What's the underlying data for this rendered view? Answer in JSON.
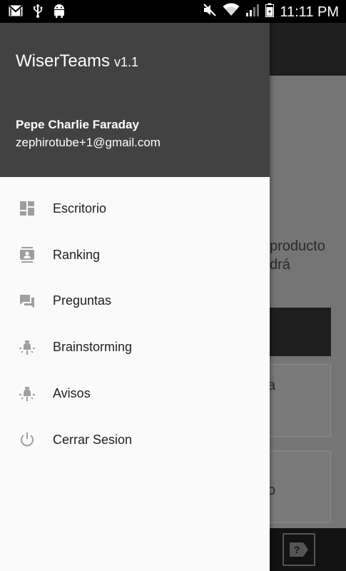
{
  "status_bar": {
    "time": "11:11 PM",
    "left_icons": [
      "gmail-icon",
      "usb-icon",
      "android-icon"
    ],
    "right_icons": [
      "mute-icon",
      "wifi-icon",
      "signal-icon",
      "battery-icon"
    ]
  },
  "drawer": {
    "app_name": "WiserTeams",
    "version": "v1.1",
    "user_name": "Pepe Charlie Faraday",
    "user_email": "zephirotube+1@gmail.com",
    "menu": [
      {
        "label": "Escritorio",
        "icon": "dashboard-icon"
      },
      {
        "label": "Ranking",
        "icon": "contact-card-icon"
      },
      {
        "label": "Preguntas",
        "icon": "forum-icon"
      },
      {
        "label": "Brainstorming",
        "icon": "lightbulb-icon"
      },
      {
        "label": "Avisos",
        "icon": "lightbulb-icon"
      },
      {
        "label": "Cerrar Sesion",
        "icon": "power-icon"
      }
    ]
  },
  "background": {
    "text_line1": "producto",
    "text_line2": "drá",
    "card1_text": "a",
    "card2_text": "o"
  },
  "colors": {
    "drawer_header": "#424242",
    "drawer_bg": "#fafafa",
    "icon_gray": "#9e9e9e",
    "text_dark": "#212121"
  }
}
